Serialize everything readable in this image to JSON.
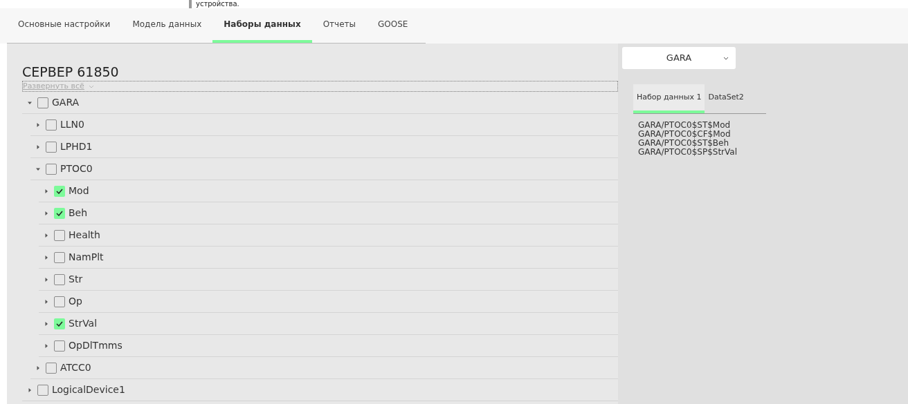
{
  "top_text": "устройства.",
  "tabs": [
    {
      "label": "Основные настройки",
      "selected": false
    },
    {
      "label": "Модель данных",
      "selected": false
    },
    {
      "label": "Наборы данных",
      "selected": true
    },
    {
      "label": "Отчеты",
      "selected": false
    },
    {
      "label": "GOOSE",
      "selected": false
    }
  ],
  "server": {
    "title": "СЕРВЕР 61850",
    "expand_all": "Развернуть всё",
    "tree": [
      {
        "label": "GARA",
        "checked": false,
        "expanded": true,
        "children": [
          {
            "label": "LLN0",
            "checked": false,
            "expanded": false
          },
          {
            "label": "LPHD1",
            "checked": false,
            "expanded": false
          },
          {
            "label": "PTOC0",
            "checked": false,
            "expanded": true,
            "children": [
              {
                "label": "Mod",
                "checked": true,
                "expanded": false
              },
              {
                "label": "Beh",
                "checked": true,
                "expanded": false
              },
              {
                "label": "Health",
                "checked": false,
                "expanded": false
              },
              {
                "label": "NamPlt",
                "checked": false,
                "expanded": false
              },
              {
                "label": "Str",
                "checked": false,
                "expanded": false
              },
              {
                "label": "Op",
                "checked": false,
                "expanded": false
              },
              {
                "label": "StrVal",
                "checked": true,
                "expanded": false
              },
              {
                "label": "OpDlTmms",
                "checked": false,
                "expanded": false
              }
            ]
          },
          {
            "label": "ATCC0",
            "checked": false,
            "expanded": false
          }
        ]
      },
      {
        "label": "LogicalDevice1",
        "checked": false,
        "expanded": false
      }
    ]
  },
  "device_select": {
    "value": "GARA"
  },
  "dataset_tabs": [
    {
      "label": "Набор данных 1",
      "selected": true
    },
    {
      "label": "DataSet2",
      "selected": false
    }
  ],
  "dataset_items": [
    "GARA/PTOC0$ST$Mod",
    "GARA/PTOC0$CF$Mod",
    "GARA/PTOC0$ST$Beh",
    "GARA/PTOC0$SP$StrVal"
  ]
}
